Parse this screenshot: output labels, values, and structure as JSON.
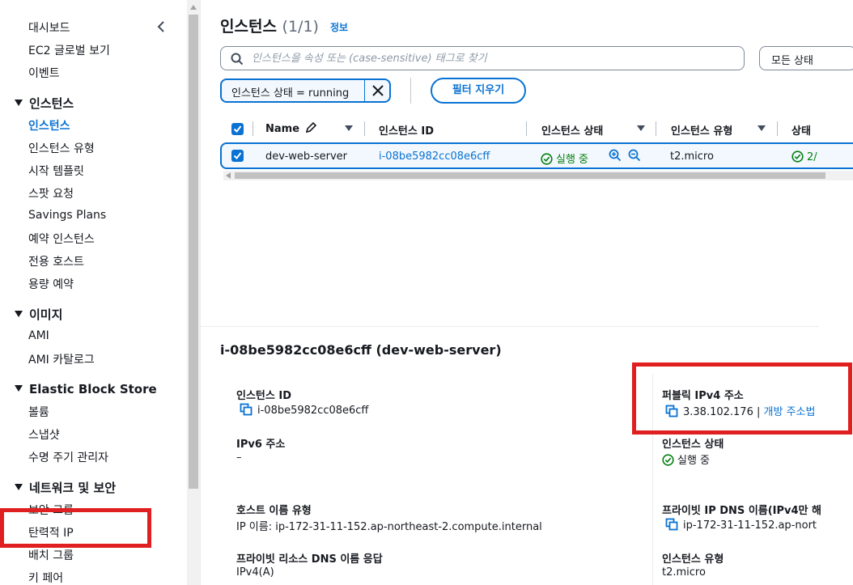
{
  "sidebar": {
    "items": [
      {
        "label": "대시보드"
      },
      {
        "label": "EC2 글로벌 보기"
      },
      {
        "label": "이벤트"
      }
    ],
    "sections": [
      {
        "label": "인스턴스",
        "items": [
          "인스턴스",
          "인스턴스 유형",
          "시작 템플릿",
          "스팟 요청",
          "Savings Plans",
          "예약 인스턴스",
          "전용 호스트",
          "용량 예약"
        ]
      },
      {
        "label": "이미지",
        "items": [
          "AMI",
          "AMI 카탈로그"
        ]
      },
      {
        "label": "Elastic Block Store",
        "items": [
          "볼륨",
          "스냅샷",
          "수명 주기 관리자"
        ]
      },
      {
        "label": "네트워크 및 보안",
        "items": [
          "보안 그룹",
          "탄력적 IP",
          "배치 그룹",
          "키 페어"
        ]
      }
    ],
    "active_item": "인스턴스"
  },
  "header": {
    "title": "인스턴스",
    "count": "(1/1)",
    "info": "정보"
  },
  "search": {
    "placeholder": "인스턴스을 속성 또는 (case-sensitive) 태그로 찾기",
    "state_filter": "모든 상태"
  },
  "filter": {
    "token": "인스턴스 상태 = running",
    "clear_label": "필터 지우기"
  },
  "table": {
    "columns": [
      "Name",
      "인스턴스 ID",
      "인스턴스 상태",
      "인스턴스 유형",
      "상태"
    ],
    "rows": [
      {
        "name": "dev-web-server",
        "instance_id": "i-08be5982cc08e6cff",
        "state": "실행 중",
        "type": "t2.micro",
        "status": "2/"
      }
    ]
  },
  "details": {
    "title": "i-08be5982cc08e6cff (dev-web-server)",
    "instance_id_label": "인스턴스 ID",
    "instance_id_value": "i-08be5982cc08e6cff",
    "ipv6_label": "IPv6 주소",
    "ipv6_value": "–",
    "hostname_type_label": "호스트 이름 유형",
    "hostname_type_value": "IP 이름: ip-172-31-11-152.ap-northeast-2.compute.internal",
    "private_dns_label": "프라이빗 리소스 DNS 이름 응답",
    "private_dns_value": "IPv4(A)",
    "public_ipv4_label": "퍼블릭 IPv4 주소",
    "public_ipv4_value": "3.38.102.176",
    "public_ipv4_sep": "|",
    "open_address_label": "개방 주소법",
    "instance_state_label": "인스턴스 상태",
    "instance_state_value": "실행 중",
    "private_ip_dns_label": "프라이빗 IP DNS 이름(IPv4만 해",
    "private_ip_dns_value": "ip-172-31-11-152.ap-nort",
    "instance_type_label": "인스턴스 유형",
    "instance_type_value": "t2.micro"
  },
  "colors": {
    "link": "#0972d3",
    "success": "#037f0c",
    "highlight": "#e02020"
  }
}
